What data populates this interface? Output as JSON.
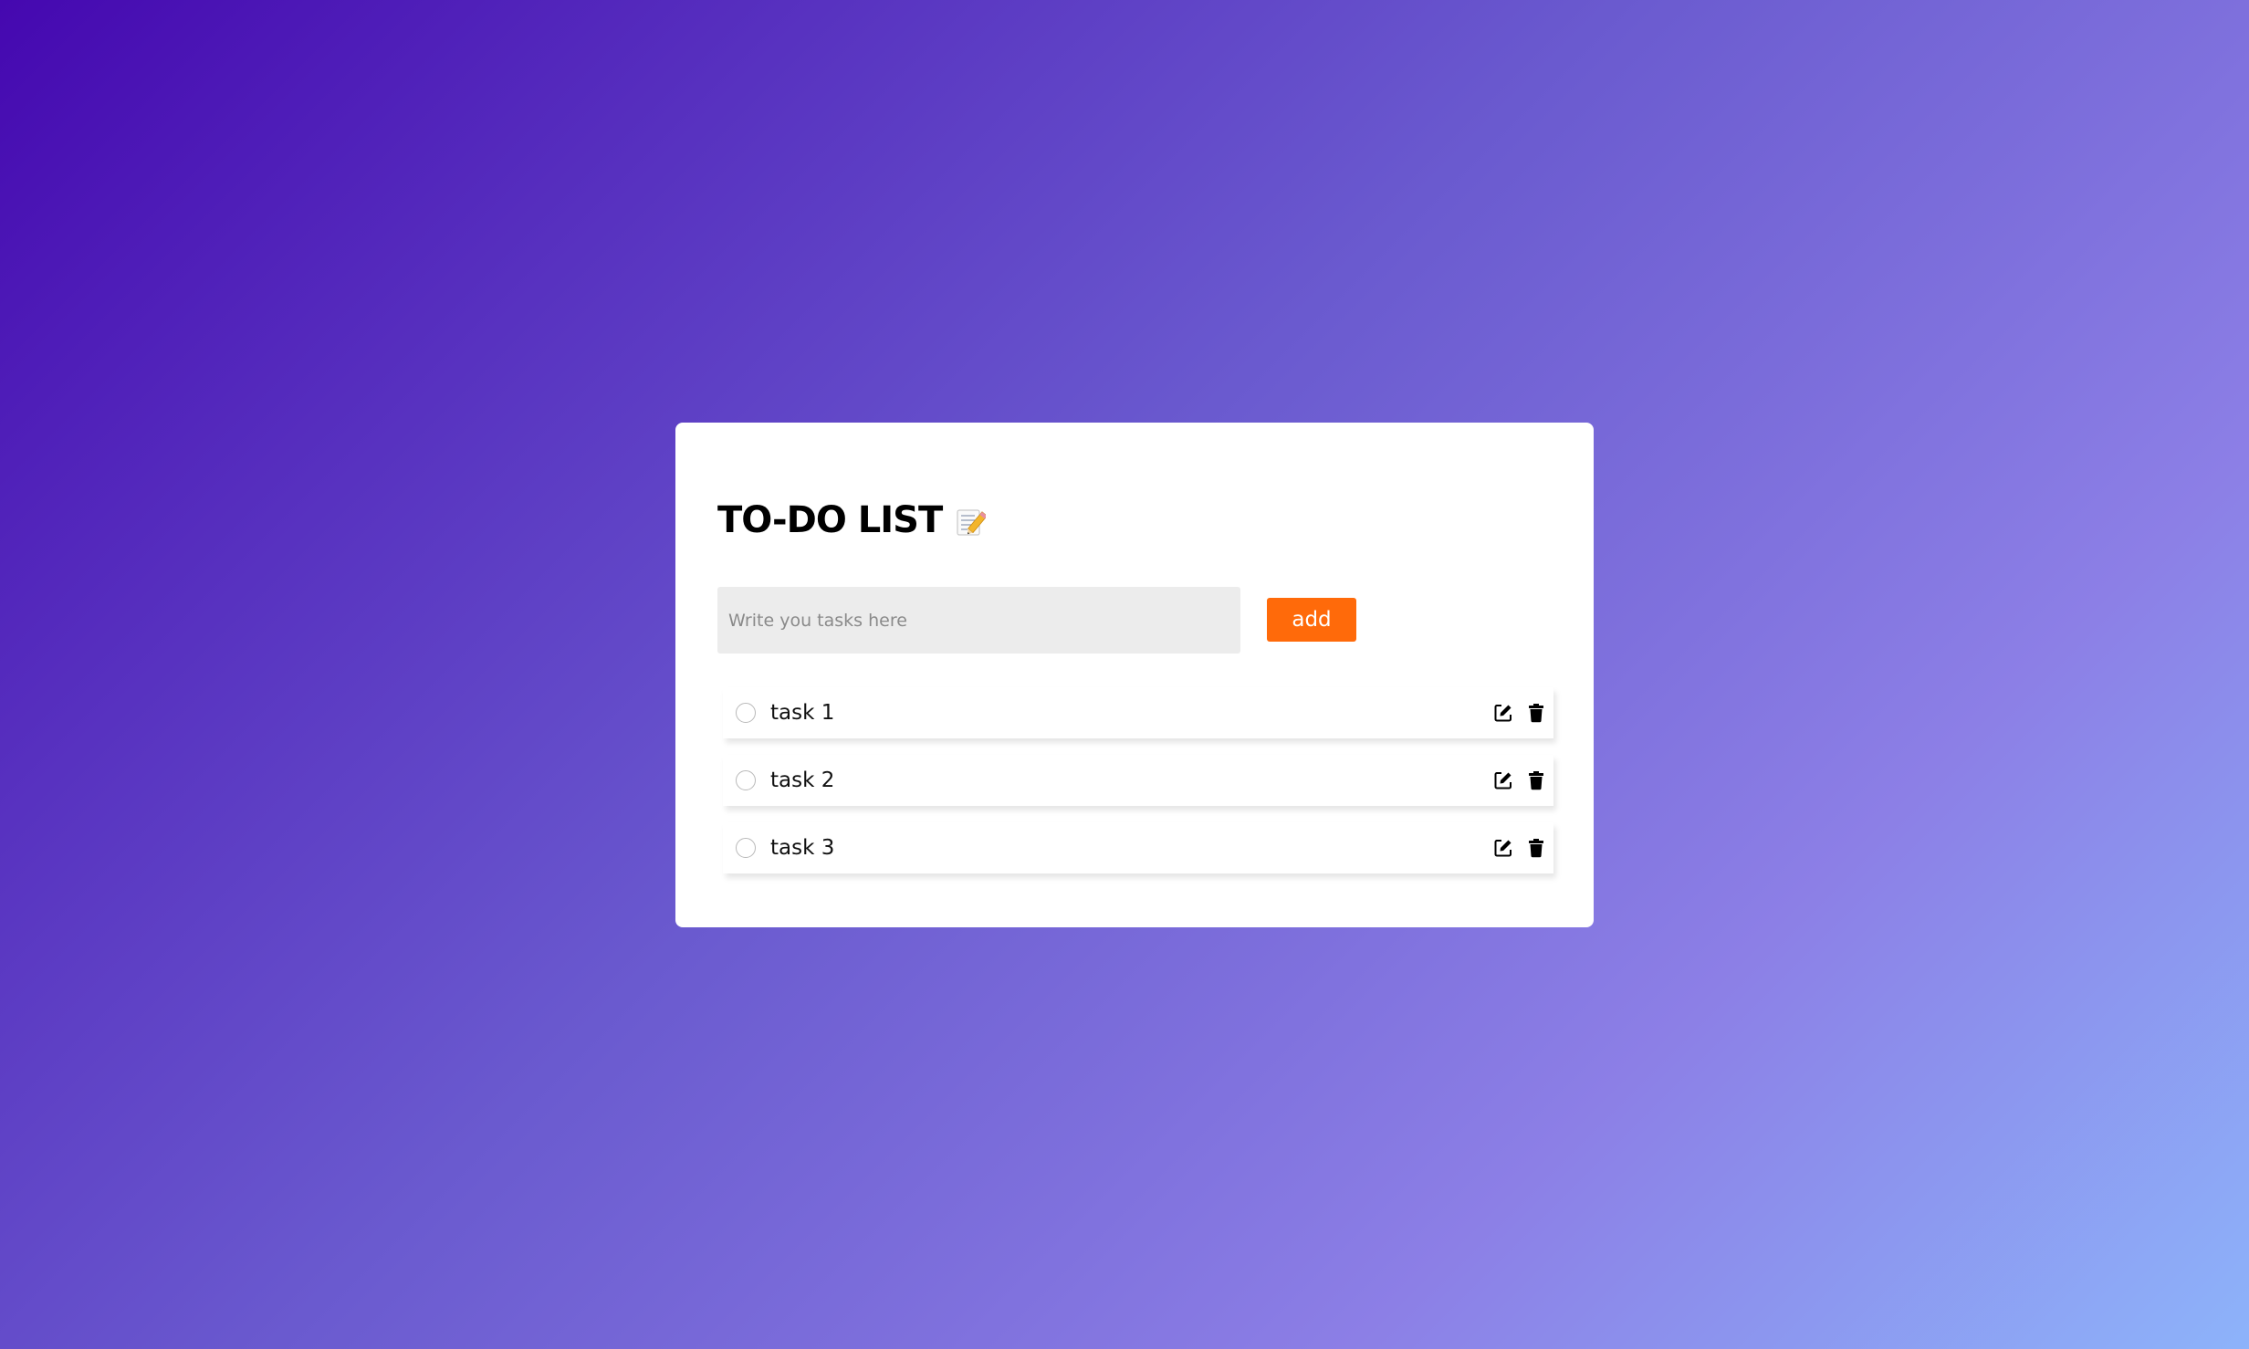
{
  "app": {
    "title": "TO-DO LIST",
    "title_icon": "memo-pencil-icon"
  },
  "input": {
    "value": "",
    "placeholder": "Write you tasks here"
  },
  "add_button": {
    "label": "add"
  },
  "tasks": [
    {
      "label": "task 1",
      "completed": false
    },
    {
      "label": "task 2",
      "completed": false
    },
    {
      "label": "task 3",
      "completed": false
    }
  ],
  "icons": {
    "edit": "edit-icon",
    "delete": "trash-icon"
  },
  "colors": {
    "accent": "#ff6a0a",
    "background_start": "#4508b0",
    "background_end": "#8db3fa",
    "card": "#ffffff",
    "input_bg": "#ececec"
  }
}
